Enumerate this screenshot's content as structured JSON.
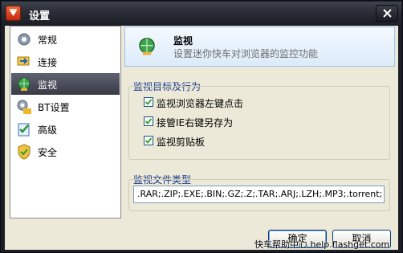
{
  "window": {
    "title": "设置",
    "title_icon": "flashget-logo-icon",
    "close_icon": "close-icon"
  },
  "sidebar": {
    "items": [
      {
        "label": "常规",
        "icon": "settings-gear-icon",
        "active": false
      },
      {
        "label": "连接",
        "icon": "connection-icon",
        "active": false
      },
      {
        "label": "监视",
        "icon": "monitor-globe-icon",
        "active": true
      },
      {
        "label": "BT设置",
        "icon": "bt-gear-icon",
        "active": false
      },
      {
        "label": "高级",
        "icon": "advanced-checklist-icon",
        "active": false
      },
      {
        "label": "安全",
        "icon": "security-shield-icon",
        "active": false
      }
    ]
  },
  "header": {
    "title": "监视",
    "description": "设置迷你快车对浏览器的监控功能",
    "icon": "monitor-globe-icon"
  },
  "monitor_group": {
    "title": "监视目标及行为",
    "options": [
      {
        "label": "监视浏览器左键点击",
        "checked": true
      },
      {
        "label": "接管IE右键另存为",
        "checked": true
      },
      {
        "label": "监视剪贴板",
        "checked": true
      }
    ]
  },
  "filetype_group": {
    "title": "监视文件类型",
    "value": ".RAR;.ZIP;.EXE;.BIN;.GZ;.Z;.TAR;.ARJ;.LZH;.MP3;.torrent;"
  },
  "buttons": {
    "ok": "确定",
    "cancel": "取消"
  },
  "watermark": "快车帮助中心 help.flashget.com",
  "colors": {
    "accent": "#1a3d8f",
    "active_item": "#4a4d5a",
    "header_bg": "#e8f2fd",
    "titlebar": "#2a2d36"
  }
}
